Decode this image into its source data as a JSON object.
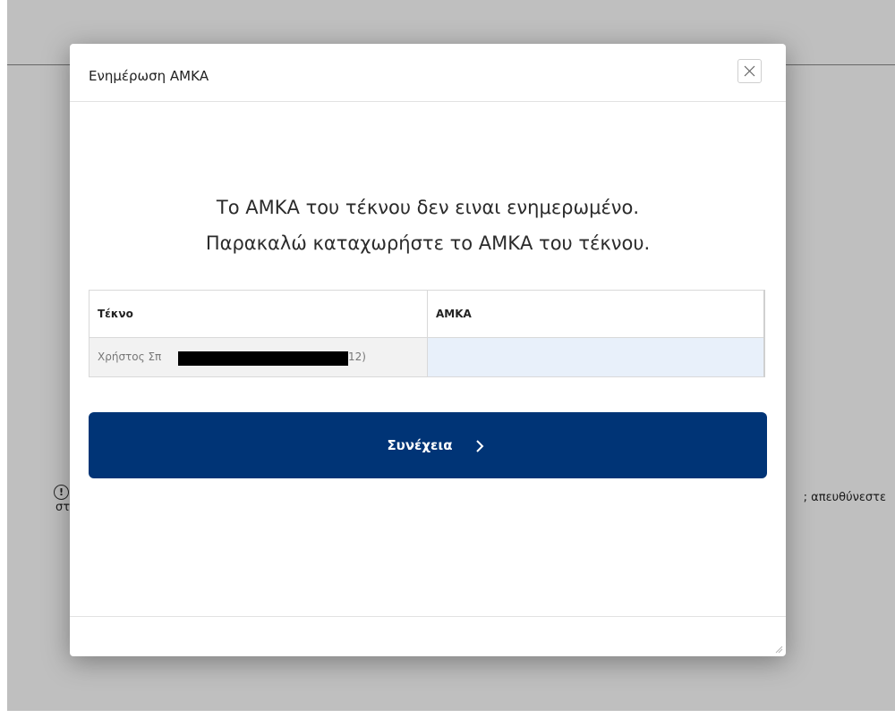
{
  "background": {
    "notice_left": "στ",
    "notice_right": "; απευθύνεστε"
  },
  "modal": {
    "title": "Ενημέρωση ΑΜΚΑ",
    "message_line1": "Το ΑΜΚΑ του τέκνου δεν ειναι ενημερωμένο.",
    "message_line2": "Παρακαλώ καταχωρήστε το ΑΜΚΑ του τέκνου.",
    "table": {
      "columns": [
        "Τέκνο",
        "ΑΜΚΑ"
      ],
      "rows": [
        {
          "child_prefix": "Χρήστος Σπ",
          "child_suffix": "12)",
          "amka_value": ""
        }
      ]
    },
    "continue_label": "Συνέχεια"
  },
  "colors": {
    "primary_button": "#003476",
    "amka_cell_bg": "#e8f0fa"
  },
  "icons": {
    "close": "close-icon",
    "continue": "chevron-right-icon",
    "notice": "info-icon"
  }
}
